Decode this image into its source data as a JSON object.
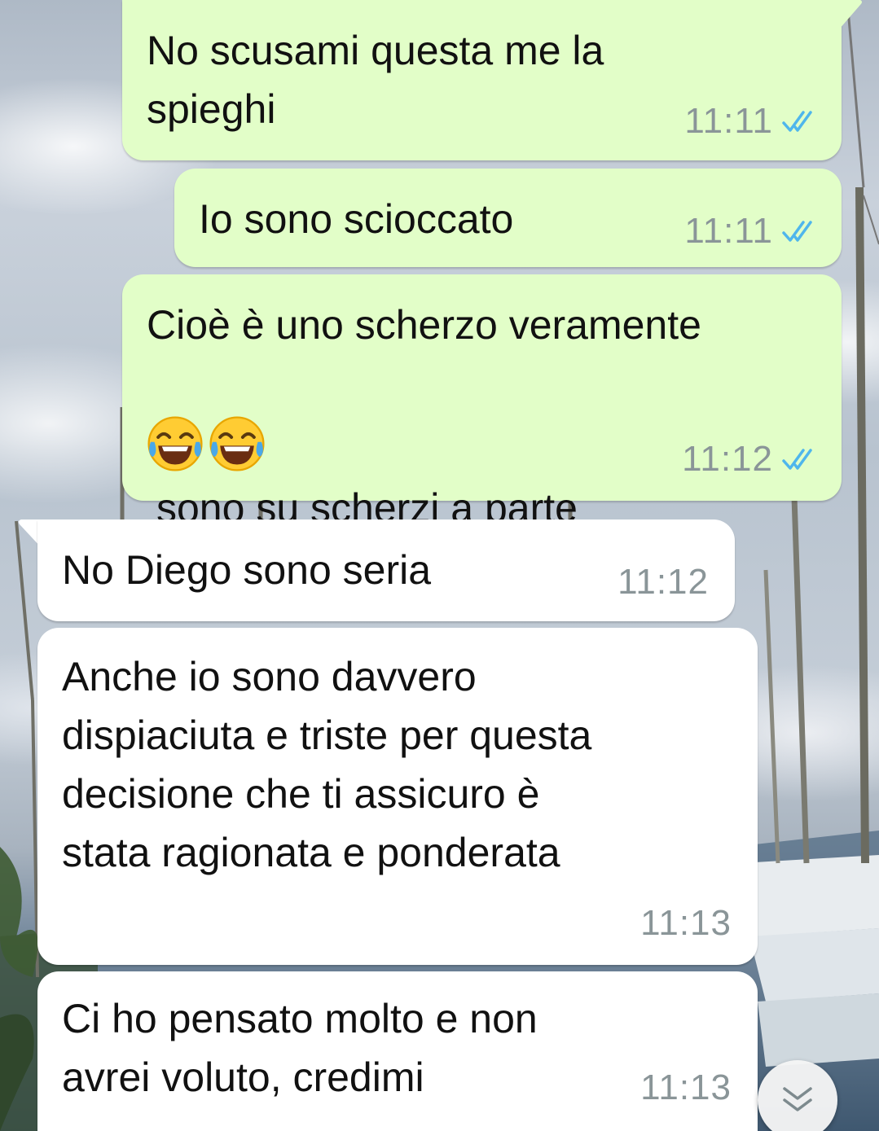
{
  "chat": {
    "messages": [
      {
        "id": "m1",
        "direction": "outgoing",
        "text": "No scusami questa me la\nspieghi",
        "time": "11:11",
        "status": "read"
      },
      {
        "id": "m2",
        "direction": "outgoing",
        "text": "Io sono scioccato",
        "time": "11:11",
        "status": "read"
      },
      {
        "id": "m3",
        "direction": "outgoing",
        "text_line1": "Cioè è uno scherzo veramente",
        "emojis": [
          "face-with-tears-of-joy",
          "face-with-tears-of-joy"
        ],
        "text_line2": "sono su scherzi a parte",
        "time": "11:12",
        "status": "read"
      },
      {
        "id": "m4",
        "direction": "incoming",
        "text": "No Diego sono seria",
        "time": "11:12"
      },
      {
        "id": "m5",
        "direction": "incoming",
        "text": "Anche io sono davvero\ndispiaciuta e triste per questa\ndecisione che ti assicuro è\nstata ragionata e ponderata",
        "time": "11:13"
      },
      {
        "id": "m6",
        "direction": "incoming",
        "text": "Ci ho pensato molto e non\navrei voluto, credimi",
        "time": "11:13"
      }
    ],
    "scroll_button_icon": "double-chevron-down-icon"
  },
  "colors": {
    "outgoing_bubble": "#e2fec8",
    "incoming_bubble": "#ffffff",
    "read_ticks": "#4fb6ec",
    "time_text": "#8a9598"
  }
}
